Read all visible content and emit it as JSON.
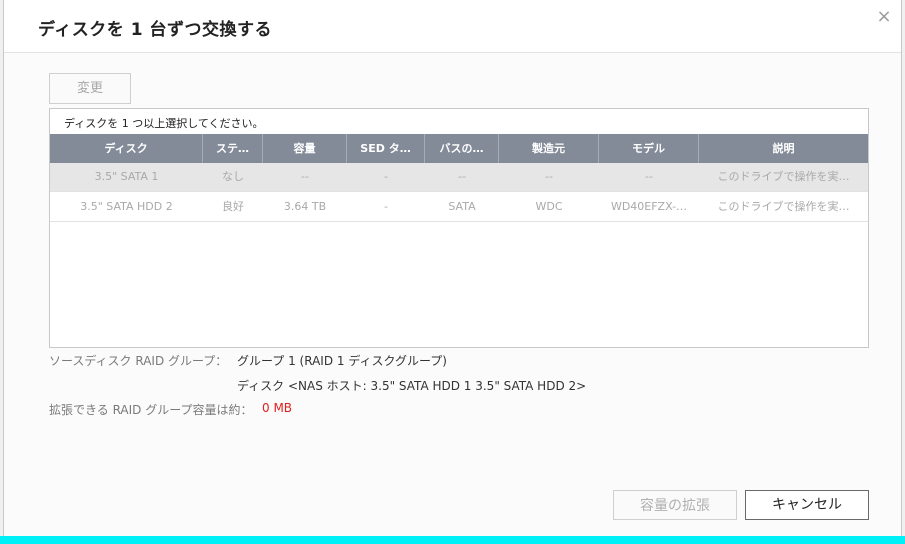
{
  "dialog": {
    "title": "ディスクを 1 台ずつ交換する",
    "close_symbol": "×"
  },
  "toolbar": {
    "change_label": "変更"
  },
  "table": {
    "hint": "ディスクを 1 つ以上選択してください。",
    "columns": [
      "ディスク",
      "ステ…",
      "容量",
      "SED タ…",
      "バスの…",
      "製造元",
      "モデル",
      "説明"
    ],
    "rows": [
      [
        "3.5\" SATA 1",
        "なし",
        "--",
        "-",
        "--",
        "--",
        "--",
        "このドライブで操作を実…"
      ],
      [
        "3.5\" SATA HDD 2",
        "良好",
        "3.64 TB",
        "-",
        "SATA",
        "WDC",
        "WD40EFZX-…",
        "このドライブで操作を実…"
      ]
    ]
  },
  "info": {
    "source_label": "ソースディスク RAID グループ：",
    "source_group": "グループ 1 (RAID 1 ディスクグループ)",
    "source_disks": "ディスク <NAS ホスト: 3.5\" SATA HDD 1 3.5\" SATA HDD 2>",
    "capacity_label": "拡張できる RAID グループ容量は約：",
    "capacity_value": "0 MB"
  },
  "footer": {
    "expand_label": "容量の拡張",
    "cancel_label": "キャンセル"
  },
  "colors": {
    "header_row": "#838b99",
    "accent_bar": "#00f0f8",
    "capacity_red": "#e02020"
  }
}
